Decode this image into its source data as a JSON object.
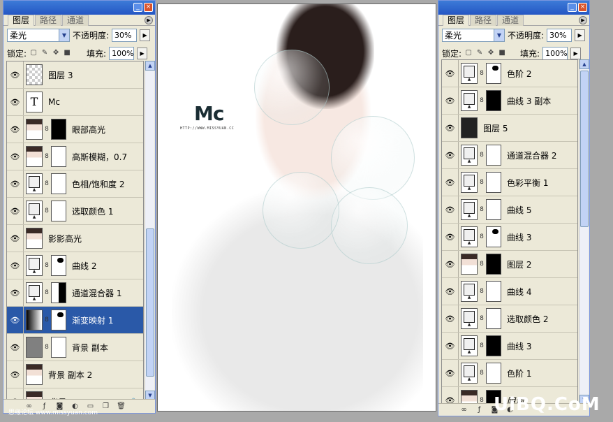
{
  "left_panel": {
    "tabs": [
      "图层",
      "路径",
      "通道"
    ],
    "blend_mode": "柔光",
    "opacity_label": "不透明度:",
    "opacity": "30%",
    "lock_label": "锁定:",
    "fill_label": "填充:",
    "fill": "100%",
    "layers": [
      {
        "name": "图层 3",
        "thumb": "checker",
        "mask": null
      },
      {
        "name": "Mc",
        "thumb": "text",
        "mask": null
      },
      {
        "name": "眼部高光",
        "thumb": "portrait",
        "mask": "black-dot"
      },
      {
        "name": "高斯模糊，0.7",
        "thumb": "portrait",
        "mask": "white"
      },
      {
        "name": "色相/饱和度 2",
        "thumb": "adjustment",
        "mask": "white"
      },
      {
        "name": "选取颜色 1",
        "thumb": "adjustment",
        "mask": "white"
      },
      {
        "name": "影影高光",
        "thumb": "portrait",
        "mask": null
      },
      {
        "name": "曲线 2",
        "thumb": "adjustment",
        "mask": "spot"
      },
      {
        "name": "通道混合器 1",
        "thumb": "adjustment",
        "mask": "half"
      },
      {
        "name": "渐变映射 1",
        "thumb": "gradient",
        "mask": "spot",
        "selected": true
      },
      {
        "name": "背景 副本",
        "thumb": "gray",
        "mask": "white"
      },
      {
        "name": "背景 副本 2",
        "thumb": "portrait",
        "mask": null
      },
      {
        "name": "背景",
        "thumb": "portrait",
        "mask": null
      }
    ]
  },
  "right_panel": {
    "tabs": [
      "图层",
      "路径",
      "通道"
    ],
    "blend_mode": "柔光",
    "opacity_label": "不透明度:",
    "opacity": "30%",
    "lock_label": "锁定:",
    "fill_label": "填充:",
    "fill": "100%",
    "layers": [
      {
        "name": "色阶 2",
        "thumb": "adjustment",
        "mask": "spot"
      },
      {
        "name": "曲线 3 副本",
        "thumb": "adjustment",
        "mask": "black"
      },
      {
        "name": "图层 5",
        "thumb": "dark",
        "mask": null
      },
      {
        "name": "通道混合器 2",
        "thumb": "adjustment",
        "mask": "white"
      },
      {
        "name": "色彩平衡 1",
        "thumb": "adjustment",
        "mask": "white"
      },
      {
        "name": "曲线 5",
        "thumb": "adjustment",
        "mask": "white"
      },
      {
        "name": "曲线 3",
        "thumb": "adjustment",
        "mask": "spot"
      },
      {
        "name": "图层 2",
        "thumb": "portrait",
        "mask": "black"
      },
      {
        "name": "曲线 4",
        "thumb": "adjustment",
        "mask": "white"
      },
      {
        "name": "选取颜色 2",
        "thumb": "adjustment",
        "mask": "white"
      },
      {
        "name": "曲线 3",
        "thumb": "adjustment",
        "mask": "black"
      },
      {
        "name": "色阶 1",
        "thumb": "adjustment",
        "mask": "white"
      },
      {
        "name": "明调",
        "thumb": "portrait",
        "mask": "black"
      }
    ]
  },
  "canvas": {
    "logo_text": "Mc",
    "logo_url": "HTTP://WWW.MISSYUAN.CC"
  },
  "watermark_left": "思缘论坛 www.missyuan.com",
  "watermark_right": "UiBQ.CoM"
}
